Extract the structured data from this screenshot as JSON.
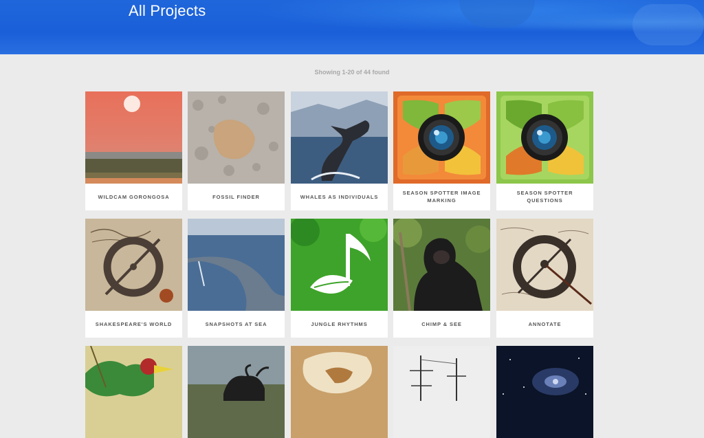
{
  "header": {
    "title": "All Projects"
  },
  "results": {
    "count_text": "Showing 1-20 of 44 found"
  },
  "projects": [
    {
      "name": "WILDCAM GORONGOSA"
    },
    {
      "name": "FOSSIL FINDER"
    },
    {
      "name": "WHALES AS INDIVIDUALS"
    },
    {
      "name": "SEASON SPOTTER IMAGE MARKING"
    },
    {
      "name": "SEASON SPOTTER QUESTIONS"
    },
    {
      "name": "SHAKESPEARE'S WORLD"
    },
    {
      "name": "SNAPSHOTS AT SEA"
    },
    {
      "name": "JUNGLE RHYTHMS"
    },
    {
      "name": "CHIMP & SEE"
    },
    {
      "name": "ANNOTATE"
    }
  ],
  "colors": {
    "header_blue": "#1f66db",
    "page_bg": "#ebebeb",
    "card_bg": "#ffffff",
    "label_text": "#555555"
  }
}
